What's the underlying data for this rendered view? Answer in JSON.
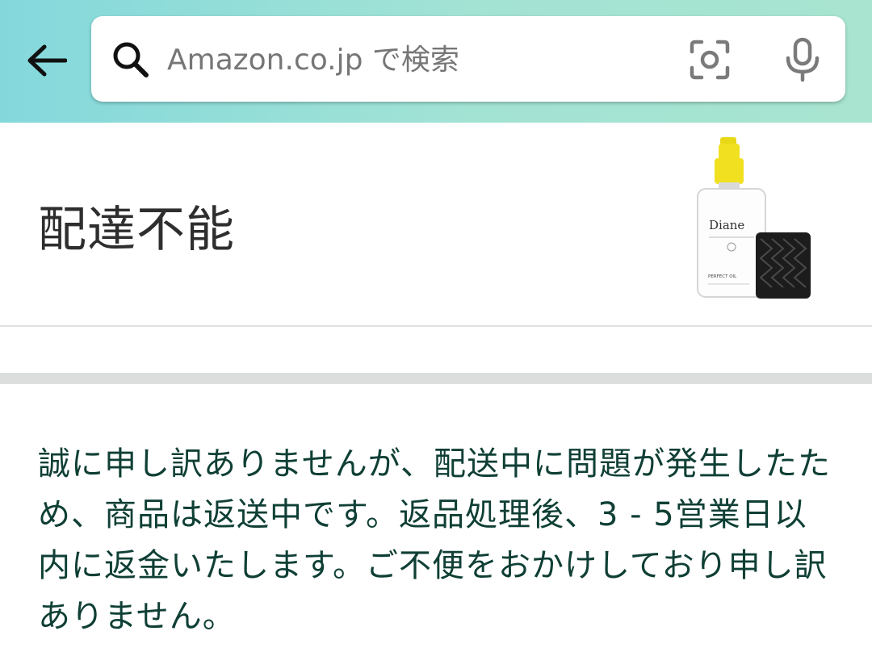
{
  "search": {
    "placeholder": "Amazon.co.jp で検索",
    "value": ""
  },
  "icons": {
    "back": "arrow-left-icon",
    "search": "search-icon",
    "camera": "camera-scan-icon",
    "mic": "microphone-icon"
  },
  "status": {
    "title": "配達不能"
  },
  "product": {
    "brand": "Diane",
    "label": "PERFECT OIL"
  },
  "message": {
    "text": "誠に申し訳ありませんが、配送中に問題が発生したため、商品は返送中です。返品処理後、3 - 5営業日以内に返金いたします。ご不便をおかけしており申し訳ありません。"
  },
  "colors": {
    "header_gradient_start": "#84d8dc",
    "header_gradient_end": "#a8e4d0",
    "message_text": "#0f3f35",
    "bottle_cap": "#f0e020"
  }
}
